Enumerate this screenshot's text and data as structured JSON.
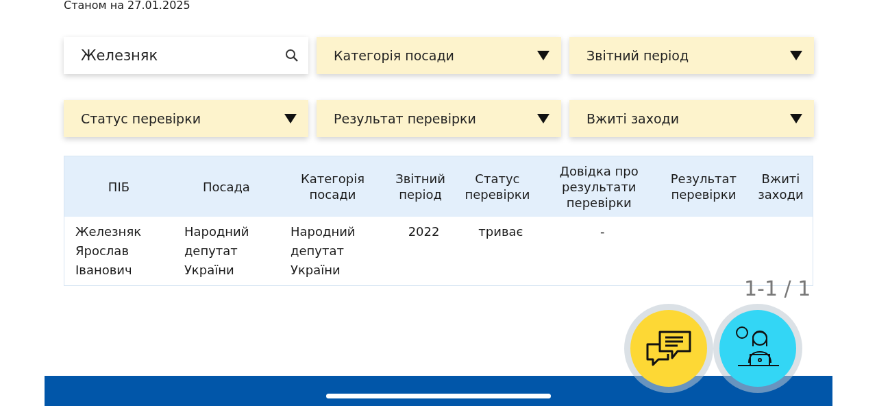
{
  "as_of": "Станом на 27.01.2025",
  "search": {
    "value": "Железняк"
  },
  "filters": [
    {
      "label": "Категорія посади"
    },
    {
      "label": "Звітний період"
    },
    {
      "label": "Статус перевірки"
    },
    {
      "label": "Результат перевірки"
    },
    {
      "label": "Вжиті заходи"
    }
  ],
  "table": {
    "columns": [
      "ПІБ",
      "Посада",
      "Категорія посади",
      "Звітний період",
      "Статус перевірки",
      "Довідка про результати перевірки",
      "Результат перевірки",
      "Вжиті заходи"
    ],
    "rows": [
      {
        "cells": [
          "Железняк Ярослав Іванович",
          "Народний депутат України",
          "Народний депутат України",
          "2022",
          "триває",
          "-",
          "",
          ""
        ]
      }
    ]
  },
  "pagination": "1-1 / 1"
}
